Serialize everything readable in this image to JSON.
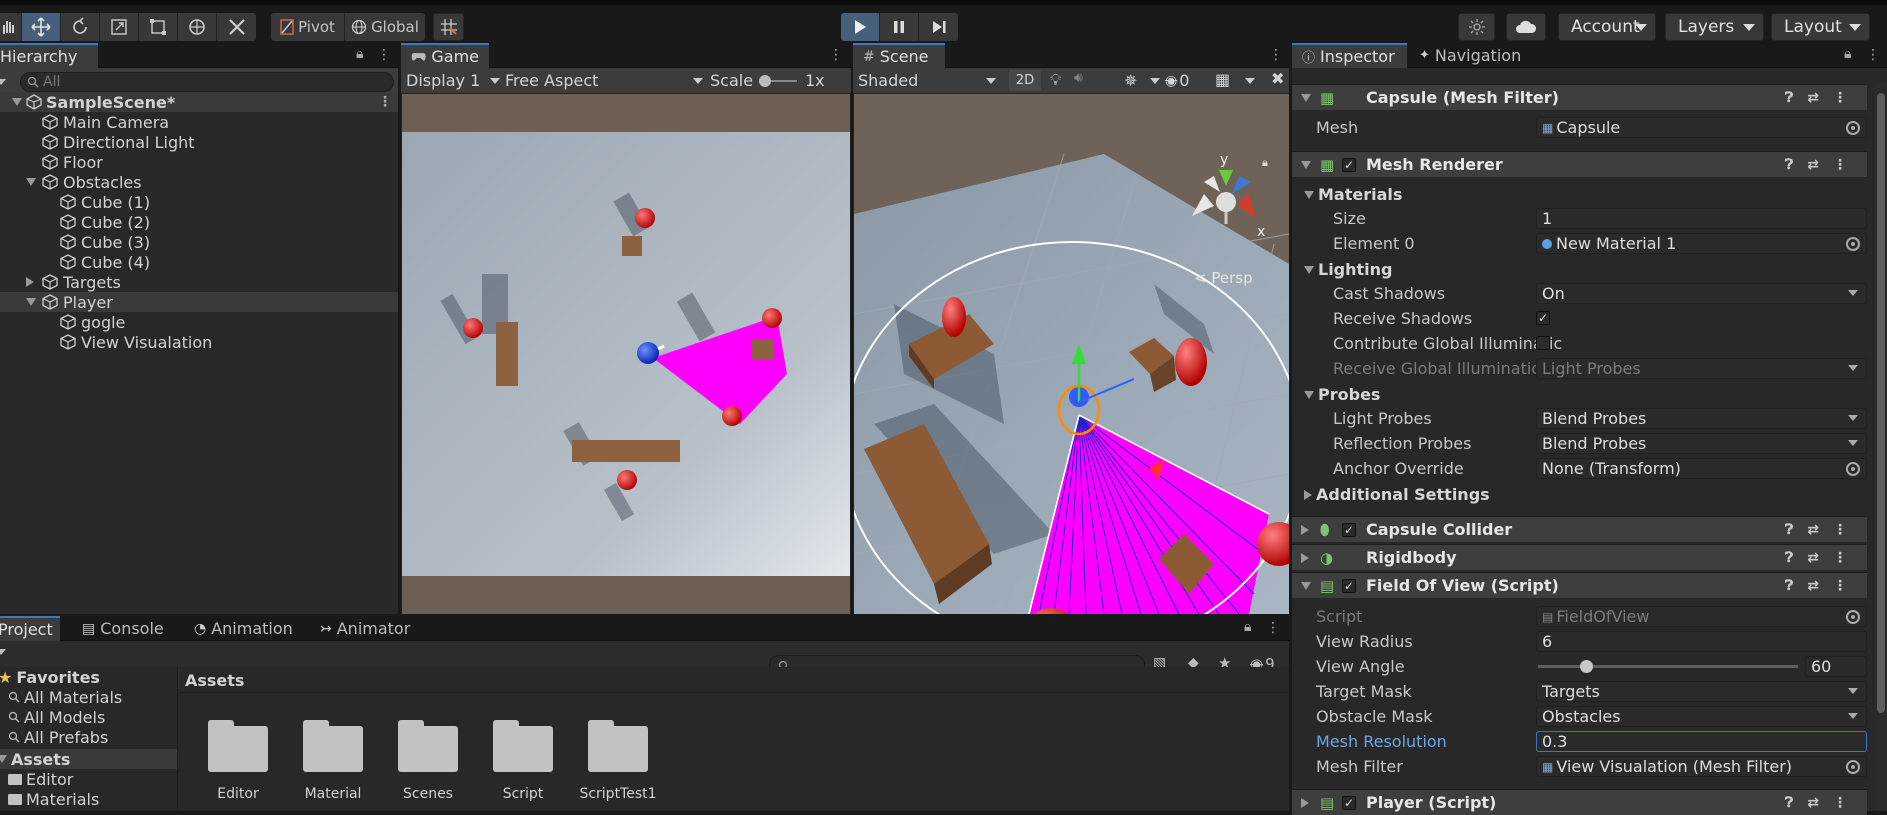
{
  "toolbar": {
    "pivot_label": "Pivot",
    "global_label": "Global",
    "account_label": "Account",
    "layers_label": "Layers",
    "layout_label": "Layout"
  },
  "hierarchy": {
    "tab_label": "Hierarchy",
    "search_placeholder": "All",
    "scene_name": "SampleScene*",
    "items": [
      {
        "label": "Main Camera"
      },
      {
        "label": "Directional Light"
      },
      {
        "label": "Floor"
      },
      {
        "label": "Obstacles"
      },
      {
        "label": "Cube (1)"
      },
      {
        "label": "Cube (2)"
      },
      {
        "label": "Cube (3)"
      },
      {
        "label": "Cube (4)"
      },
      {
        "label": "Targets"
      },
      {
        "label": "Player"
      },
      {
        "label": "gogle"
      },
      {
        "label": "View Visualation"
      }
    ]
  },
  "game": {
    "tab_label": "Game",
    "display": "Display 1",
    "aspect": "Free Aspect",
    "scale_label": "Scale",
    "scale_value": "1x"
  },
  "scene": {
    "tab_label": "Scene",
    "shading": "Shaded",
    "mode_2d": "2D",
    "hidden_count": "0",
    "persp_label": "Persp",
    "gizmo_y": "y",
    "gizmo_x": "x"
  },
  "inspector": {
    "tab_label": "Inspector",
    "nav_tab_label": "Navigation",
    "mesh_filter": {
      "title": "Capsule (Mesh Filter)",
      "mesh_label": "Mesh",
      "mesh_value": "Capsule"
    },
    "mesh_renderer": {
      "title": "Mesh Renderer",
      "materials_label": "Materials",
      "size_label": "Size",
      "size_value": "1",
      "element0_label": "Element 0",
      "element0_value": "New Material 1",
      "lighting_label": "Lighting",
      "cast_shadows_label": "Cast Shadows",
      "cast_shadows_value": "On",
      "receive_shadows_label": "Receive Shadows",
      "contribute_gi_label": "Contribute Global Illuminatic",
      "receive_gi_label": "Receive Global Illumination",
      "receive_gi_value": "Light Probes",
      "probes_label": "Probes",
      "light_probes_label": "Light Probes",
      "light_probes_value": "Blend Probes",
      "reflection_probes_label": "Reflection Probes",
      "reflection_probes_value": "Blend Probes",
      "anchor_override_label": "Anchor Override",
      "anchor_override_value": "None (Transform)",
      "additional_settings_label": "Additional Settings"
    },
    "capsule_collider": {
      "title": "Capsule Collider"
    },
    "rigidbody": {
      "title": "Rigidbody"
    },
    "fov": {
      "title": "Field Of View (Script)",
      "script_label": "Script",
      "script_value": "FieldOfView",
      "view_radius_label": "View Radius",
      "view_radius_value": "6",
      "view_angle_label": "View Angle",
      "view_angle_value": "60",
      "target_mask_label": "Target Mask",
      "target_mask_value": "Targets",
      "obstacle_mask_label": "Obstacle Mask",
      "obstacle_mask_value": "Obstacles",
      "mesh_resolution_label": "Mesh Resolution",
      "mesh_resolution_value": "0.3",
      "mesh_filter_label": "Mesh Filter",
      "mesh_filter_value": "View Visualation (Mesh Filter)"
    },
    "player_script": {
      "title": "Player (Script)"
    }
  },
  "project": {
    "tabs": [
      {
        "label": "Project"
      },
      {
        "label": "Console"
      },
      {
        "label": "Animation"
      },
      {
        "label": "Animator"
      }
    ],
    "hidden_count": "9",
    "favorites_label": "Favorites",
    "favorites": [
      {
        "label": "All Materials"
      },
      {
        "label": "All Models"
      },
      {
        "label": "All Prefabs"
      }
    ],
    "assets_label": "Assets",
    "tree_items": [
      {
        "label": "Editor"
      },
      {
        "label": "Materials"
      }
    ],
    "breadcrumb": "Assets",
    "folders": [
      {
        "label": "Editor"
      },
      {
        "label": "Material"
      },
      {
        "label": "Scenes"
      },
      {
        "label": "Script"
      },
      {
        "label": "ScriptTest1"
      }
    ]
  },
  "colors": {
    "accent": "#3a79bb",
    "fov_magenta": "#ff00ff",
    "panel_bg": "#282828"
  }
}
